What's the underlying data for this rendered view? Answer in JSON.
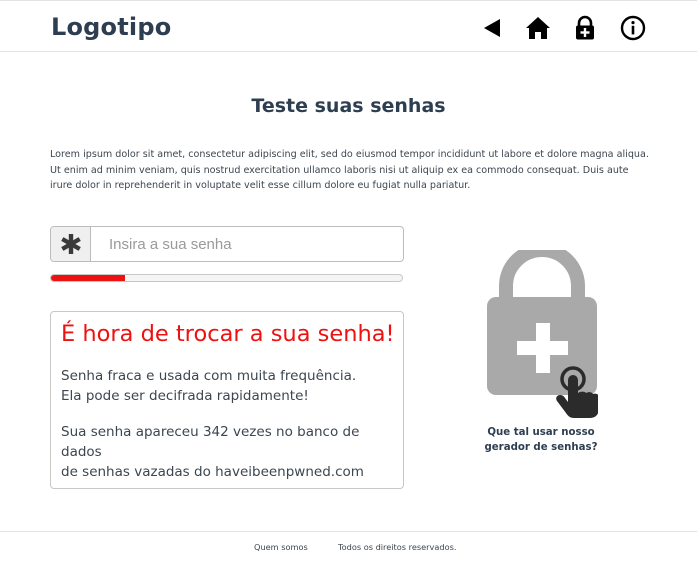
{
  "header": {
    "logo": "Logotipo",
    "icons": [
      "back-triangle-icon",
      "home-icon",
      "lock-plus-icon",
      "info-icon"
    ]
  },
  "main": {
    "title": "Teste suas senhas",
    "intro": "Lorem ipsum dolor sit amet, consectetur adipiscing elit, sed do eiusmod tempor incididunt ut labore et dolore magna aliqua. Ut enim ad minim veniam, quis nostrud exercitation ullamco laboris nisi ut aliquip ex ea commodo consequat. Duis aute irure dolor in reprehenderit in voluptate velit esse cillum dolore eu fugiat nulla pariatur.",
    "password": {
      "placeholder": "Insira a sua senha",
      "value": "",
      "addon_icon": "asterisk-icon"
    },
    "strength": {
      "level": 0.21,
      "color": "#ee1111"
    },
    "result": {
      "title": "É hora de trocar a sua senha!",
      "line1": "Senha fraca e usada com muita frequência.",
      "line2": "Ela pode ser decifrada rapidamente!",
      "line3": "Sua senha apareceu 342 vezes no banco de dados",
      "line4": "de senhas vazadas do haveibeenpwned.com"
    },
    "generator": {
      "icon": "lock-plus-tap-icon",
      "caption_line1": "Que tal usar nosso",
      "caption_line2": "gerador de senhas?"
    }
  },
  "footer": {
    "about": "Quem somos",
    "rights": "Todos os direitos reservados."
  },
  "colors": {
    "text_dark": "#2d3e50",
    "alert_red": "#ee1111",
    "lock_gray": "#a9a9a9"
  }
}
